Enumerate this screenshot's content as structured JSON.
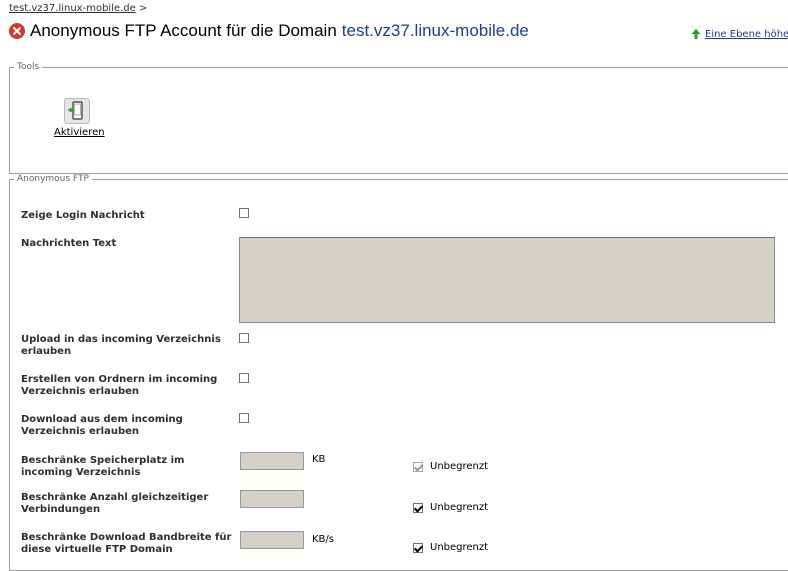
{
  "breadcrumb": {
    "link": "test.vz37.linux-mobile.de",
    "separator": ">"
  },
  "header": {
    "title": "Anonymous FTP Account für die Domain",
    "domain": "test.vz37.linux-mobile.de",
    "up_link": "Eine Ebene höher"
  },
  "tools": {
    "legend": "Tools",
    "activate_label": "Aktivieren"
  },
  "anon_ftp": {
    "legend": "Anonymous FTP",
    "fields": {
      "login_message": {
        "label": "Zeige Login Nachricht",
        "checked": false
      },
      "message_text": {
        "label": "Nachrichten Text",
        "value": ""
      },
      "upload_incoming": {
        "label": "Upload in das incoming Verzeichnis erlauben",
        "checked": false
      },
      "create_folders": {
        "label": "Erstellen von Ordnern im incoming Verzeichnis erlauben",
        "checked": false
      },
      "download_incoming": {
        "label": "Download aus dem incoming Verzeichnis erlauben",
        "checked": false
      },
      "limit_space": {
        "label": "Beschränke Speicherplatz im incoming Verzeichnis",
        "value": "",
        "unit": "KB",
        "unlimited_label": "Unbegrenzt",
        "unlimited": true,
        "unlimited_disabled": true
      },
      "limit_connections": {
        "label": "Beschränke Anzahl gleichzeitiger Verbindungen",
        "value": "",
        "unlimited_label": "Unbegrenzt",
        "unlimited": true
      },
      "limit_bandwidth": {
        "label": "Beschränke Download Bandbreite für diese virtuelle FTP Domain",
        "value": "",
        "unit": "KB/s",
        "unlimited_label": "Unbegrenzt",
        "unlimited": true
      }
    }
  }
}
